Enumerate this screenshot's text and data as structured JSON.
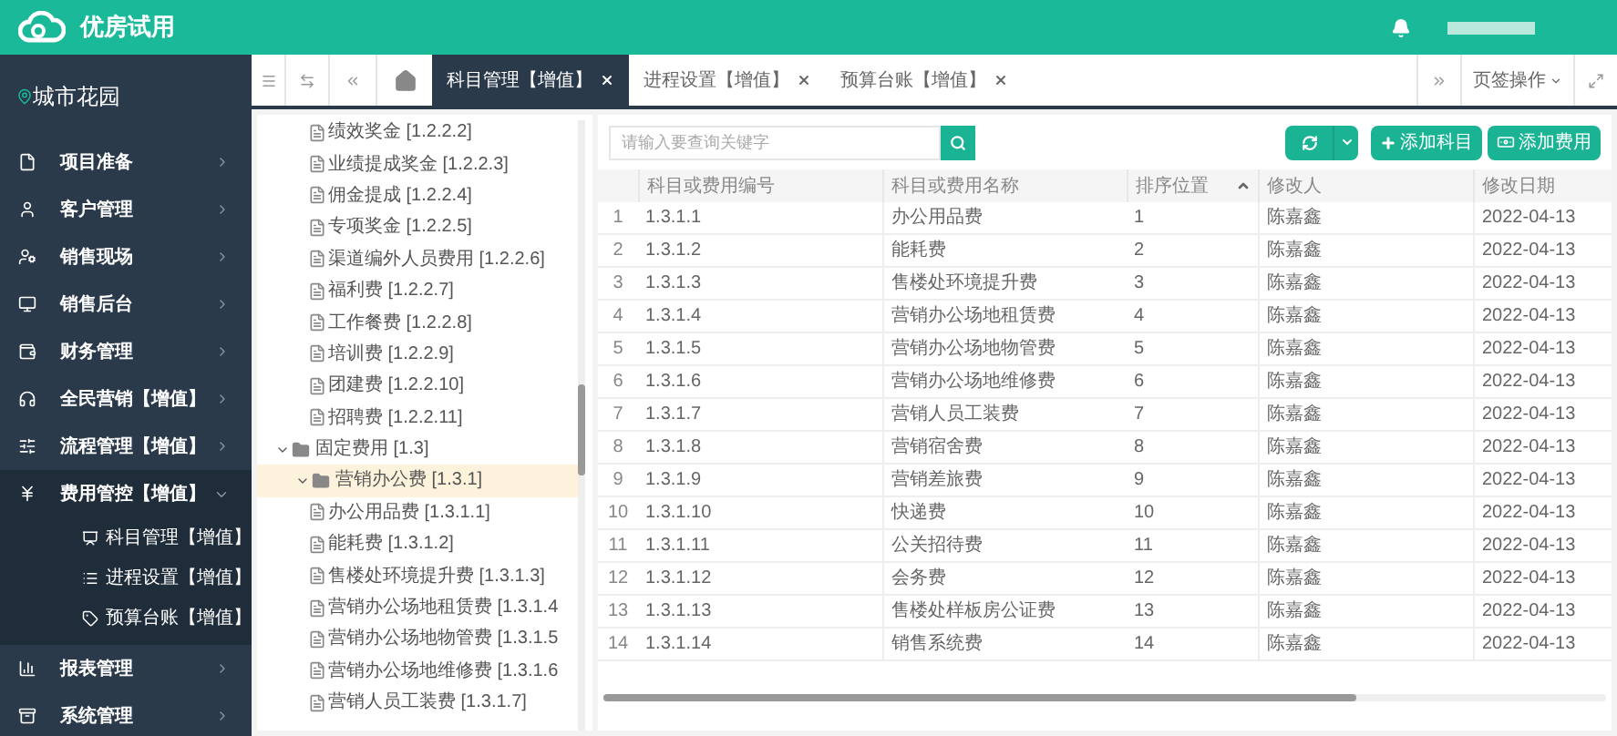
{
  "header": {
    "brand": "优房试用"
  },
  "sidebar": {
    "project": "城市花园",
    "items": [
      {
        "label": "项目准备",
        "expanded": false
      },
      {
        "label": "客户管理",
        "expanded": false
      },
      {
        "label": "销售现场",
        "expanded": false
      },
      {
        "label": "销售后台",
        "expanded": false
      },
      {
        "label": "财务管理",
        "expanded": false
      },
      {
        "label": "全民营销【增值】",
        "expanded": false
      },
      {
        "label": "流程管理【增值】",
        "expanded": false
      },
      {
        "label": "费用管控【增值】",
        "expanded": true,
        "children": [
          {
            "label": "科目管理【增值】"
          },
          {
            "label": "进程设置【增值】"
          },
          {
            "label": "预算台账【增值】"
          }
        ]
      },
      {
        "label": "报表管理",
        "expanded": false
      },
      {
        "label": "系统管理",
        "expanded": false
      }
    ]
  },
  "tabbar": {
    "tabs": [
      {
        "label": "科目管理【增值】",
        "selected": true
      },
      {
        "label": "进程设置【增值】",
        "selected": false
      },
      {
        "label": "预算台账【增值】",
        "selected": false
      }
    ],
    "page_menu": "页签操作"
  },
  "tree": {
    "items": [
      {
        "label": "绩效奖金 [1.2.2.2]"
      },
      {
        "label": "业绩提成奖金 [1.2.2.3]"
      },
      {
        "label": "佣金提成 [1.2.2.4]"
      },
      {
        "label": "专项奖金 [1.2.2.5]"
      },
      {
        "label": "渠道编外人员费用 [1.2.2.6]"
      },
      {
        "label": "福利费 [1.2.2.7]"
      },
      {
        "label": "工作餐费 [1.2.2.8]"
      },
      {
        "label": "培训费 [1.2.2.9]"
      },
      {
        "label": "团建费 [1.2.2.10]"
      },
      {
        "label": "招聘费 [1.2.2.11]"
      },
      {
        "label": "固定费用 [1.3]",
        "expanded": true,
        "selected": false,
        "children": [
          {
            "label": "营销办公费 [1.3.1]",
            "expanded": true,
            "selected": true,
            "children": [
              {
                "label": "办公用品费 [1.3.1.1]"
              },
              {
                "label": "能耗费 [1.3.1.2]"
              },
              {
                "label": "售楼处环境提升费 [1.3.1.3]"
              },
              {
                "label": "营销办公场地租赁费 [1.3.1.4"
              },
              {
                "label": "营销办公场地物管费 [1.3.1.5"
              },
              {
                "label": "营销办公场地维修费 [1.3.1.6"
              },
              {
                "label": "营销人员工装费 [1.3.1.7]"
              }
            ]
          }
        ]
      }
    ]
  },
  "toolbar": {
    "search_placeholder": "请输入要查询关键字",
    "buttons": [
      "添加科目",
      "添加费用"
    ]
  },
  "table": {
    "columns": [
      {
        "label": "科目或费用编号",
        "sortable": false
      },
      {
        "label": "科目或费用名称",
        "sortable": false
      },
      {
        "label": "排序位置",
        "sortable": true
      },
      {
        "label": "修改人",
        "sortable": false
      },
      {
        "label": "修改日期",
        "sortable": false
      }
    ],
    "rows": [
      {
        "index": "1",
        "code": "1.3.1.1",
        "name": "办公用品费",
        "order": "1",
        "editor": "陈嘉鑫",
        "date": "2022-04-13"
      },
      {
        "index": "2",
        "code": "1.3.1.2",
        "name": "能耗费",
        "order": "2",
        "editor": "陈嘉鑫",
        "date": "2022-04-13"
      },
      {
        "index": "3",
        "code": "1.3.1.3",
        "name": "售楼处环境提升费",
        "order": "3",
        "editor": "陈嘉鑫",
        "date": "2022-04-13"
      },
      {
        "index": "4",
        "code": "1.3.1.4",
        "name": "营销办公场地租赁费",
        "order": "4",
        "editor": "陈嘉鑫",
        "date": "2022-04-13"
      },
      {
        "index": "5",
        "code": "1.3.1.5",
        "name": "营销办公场地物管费",
        "order": "5",
        "editor": "陈嘉鑫",
        "date": "2022-04-13"
      },
      {
        "index": "6",
        "code": "1.3.1.6",
        "name": "营销办公场地维修费",
        "order": "6",
        "editor": "陈嘉鑫",
        "date": "2022-04-13"
      },
      {
        "index": "7",
        "code": "1.3.1.7",
        "name": "营销人员工装费",
        "order": "7",
        "editor": "陈嘉鑫",
        "date": "2022-04-13"
      },
      {
        "index": "8",
        "code": "1.3.1.8",
        "name": "营销宿舍费",
        "order": "8",
        "editor": "陈嘉鑫",
        "date": "2022-04-13"
      },
      {
        "index": "9",
        "code": "1.3.1.9",
        "name": "营销差旅费",
        "order": "9",
        "editor": "陈嘉鑫",
        "date": "2022-04-13"
      },
      {
        "index": "10",
        "code": "1.3.1.10",
        "name": "快递费",
        "order": "10",
        "editor": "陈嘉鑫",
        "date": "2022-04-13"
      },
      {
        "index": "11",
        "code": "1.3.1.11",
        "name": "公关招待费",
        "order": "11",
        "editor": "陈嘉鑫",
        "date": "2022-04-13"
      },
      {
        "index": "12",
        "code": "1.3.1.12",
        "name": "会务费",
        "order": "12",
        "editor": "陈嘉鑫",
        "date": "2022-04-13"
      },
      {
        "index": "13",
        "code": "1.3.1.13",
        "name": "售楼处样板房公证费",
        "order": "13",
        "editor": "陈嘉鑫",
        "date": "2022-04-13"
      },
      {
        "index": "14",
        "code": "1.3.1.14",
        "name": "销售系统费",
        "order": "14",
        "editor": "陈嘉鑫",
        "date": "2022-04-13"
      }
    ]
  }
}
